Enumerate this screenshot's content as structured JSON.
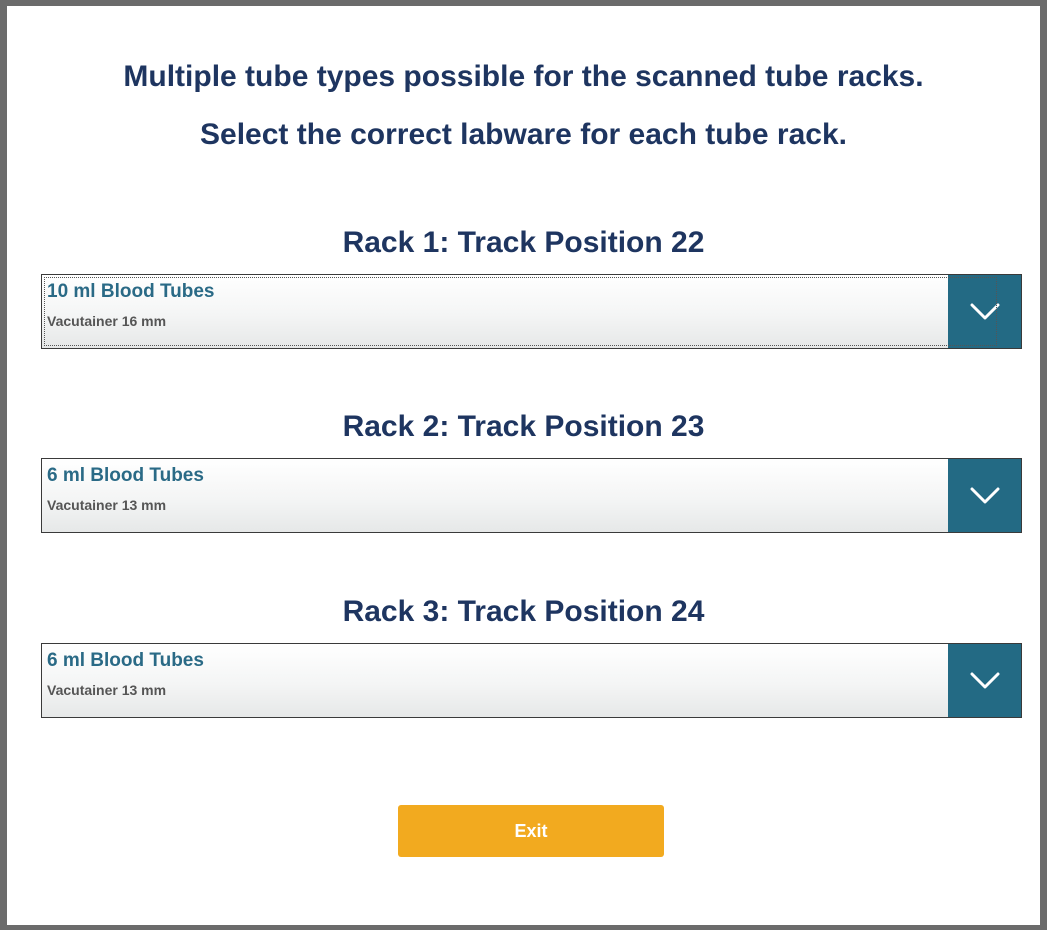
{
  "header": {
    "line1": "Multiple tube types possible for the scanned tube racks.",
    "line2": "Select the correct labware for each tube rack."
  },
  "racks": [
    {
      "title": "Rack 1: Track Position 22",
      "selected_main": "10 ml Blood Tubes",
      "selected_sub": "Vacutainer 16 mm",
      "icon": "chevron-down-icon"
    },
    {
      "title": "Rack 2: Track Position 23",
      "selected_main": "6 ml Blood Tubes",
      "selected_sub": "Vacutainer 13 mm",
      "icon": "chevron-down-icon"
    },
    {
      "title": "Rack 3: Track Position 24",
      "selected_main": "6 ml Blood Tubes",
      "selected_sub": "Vacutainer 13 mm",
      "icon": "chevron-down-icon"
    }
  ],
  "exit_label": "Exit",
  "colors": {
    "heading": "#1e3560",
    "selected_text": "#2a6a86",
    "dropdown_button": "#236a84",
    "exit_button": "#f2aa1f",
    "frame": "#6b6b6b"
  }
}
